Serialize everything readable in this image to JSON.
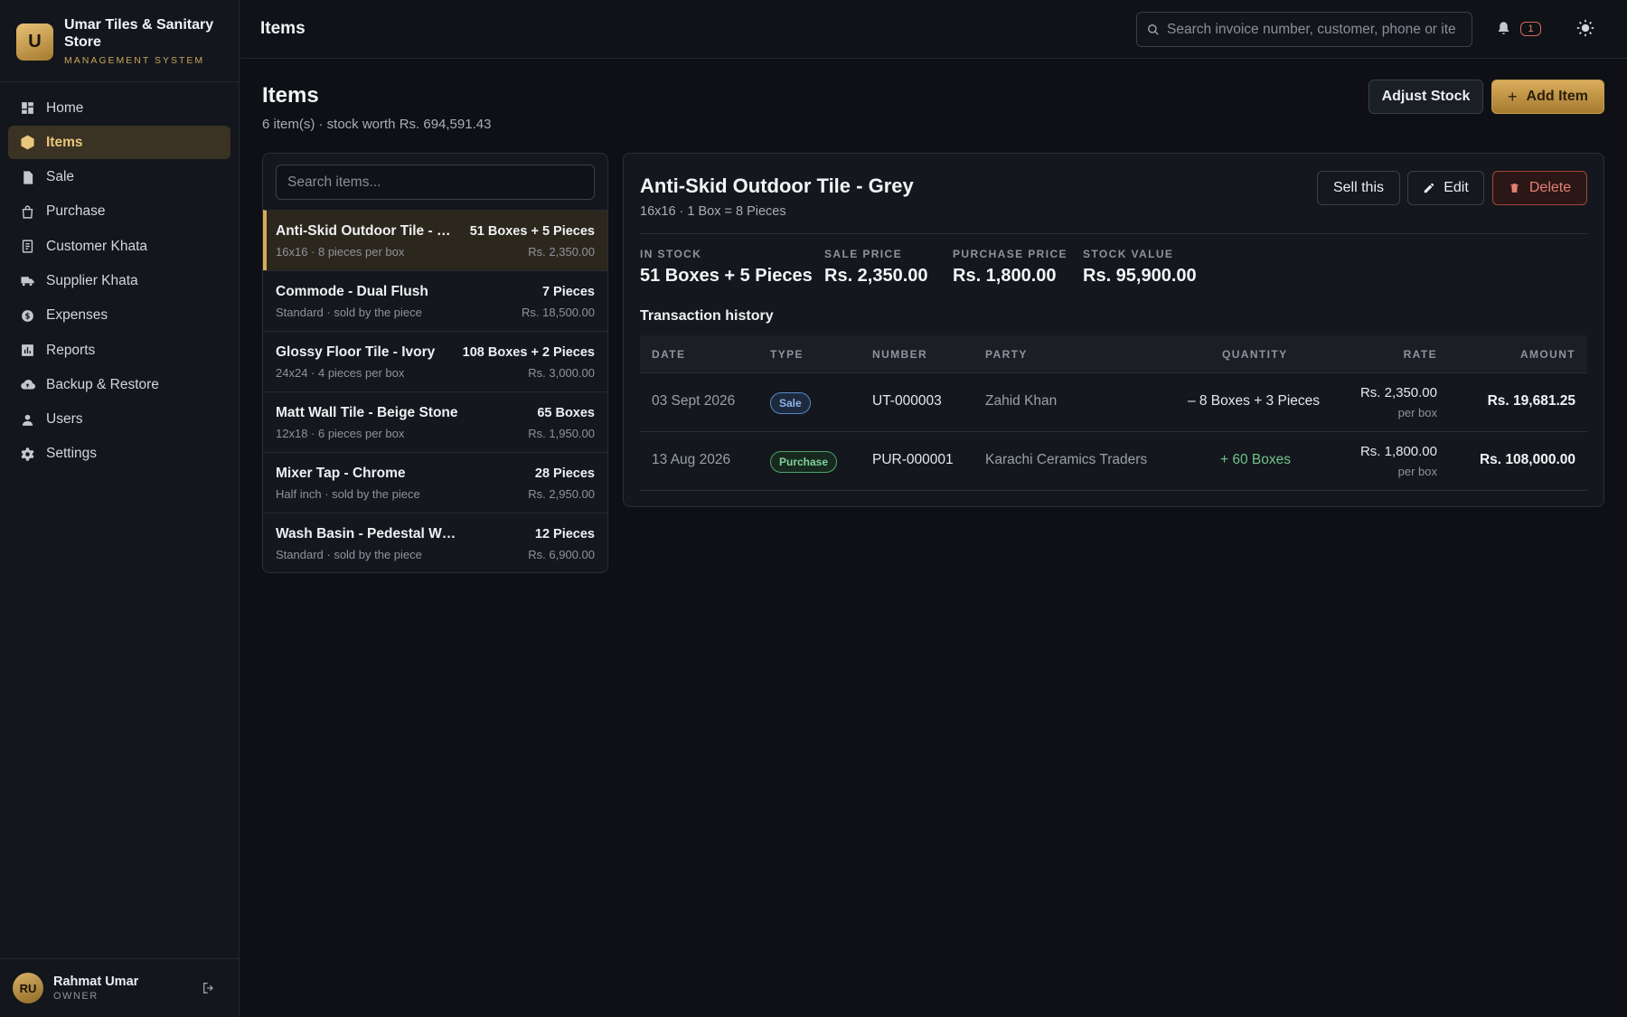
{
  "brand": {
    "logo_letter": "U",
    "name_line1": "Umar Tiles & Sanitary",
    "name_line2": "Store",
    "subtitle": "MANAGEMENT SYSTEM"
  },
  "nav": [
    {
      "label": "Home",
      "icon": "dashboard-icon"
    },
    {
      "label": "Items",
      "icon": "box-icon",
      "active": true
    },
    {
      "label": "Sale",
      "icon": "document-icon"
    },
    {
      "label": "Purchase",
      "icon": "shopping-bag-icon"
    },
    {
      "label": "Customer Khata",
      "icon": "ledger-icon"
    },
    {
      "label": "Supplier Khata",
      "icon": "truck-icon"
    },
    {
      "label": "Expenses",
      "icon": "coin-icon"
    },
    {
      "label": "Reports",
      "icon": "chart-icon"
    },
    {
      "label": "Backup & Restore",
      "icon": "cloud-upload-icon"
    },
    {
      "label": "Users",
      "icon": "user-icon"
    },
    {
      "label": "Settings",
      "icon": "gear-icon"
    }
  ],
  "user": {
    "initials": "RU",
    "name": "Rahmat Umar",
    "role": "OWNER"
  },
  "topbar": {
    "title": "Items",
    "search_placeholder": "Search invoice number, customer, phone or item",
    "notification_count": "1"
  },
  "page": {
    "title": "Items",
    "subtitle": "6 item(s) · stock worth Rs. 694,591.43",
    "adjust_label": "Adjust Stock",
    "add_label": "Add Item"
  },
  "list": {
    "search_placeholder": "Search items...",
    "items": [
      {
        "name": "Anti-Skid Outdoor Tile - Grey",
        "desc": "16x16 · 8 pieces per box",
        "qty": "51 Boxes + 5 Pieces",
        "price": "Rs. 2,350.00",
        "selected": true
      },
      {
        "name": "Commode - Dual Flush",
        "desc": "Standard · sold by the piece",
        "qty": "7 Pieces",
        "price": "Rs. 18,500.00"
      },
      {
        "name": "Glossy Floor Tile - Ivory",
        "desc": "24x24 · 4 pieces per box",
        "qty": "108 Boxes + 2 Pieces",
        "price": "Rs. 3,000.00"
      },
      {
        "name": "Matt Wall Tile - Beige Stone",
        "desc": "12x18 · 6 pieces per box",
        "qty": "65 Boxes",
        "price": "Rs. 1,950.00"
      },
      {
        "name": "Mixer Tap - Chrome",
        "desc": "Half inch · sold by the piece",
        "qty": "28 Pieces",
        "price": "Rs. 2,950.00"
      },
      {
        "name": "Wash Basin - Pedestal White",
        "desc": "Standard · sold by the piece",
        "qty": "12 Pieces",
        "price": "Rs. 6,900.00"
      }
    ]
  },
  "detail": {
    "title": "Anti-Skid Outdoor Tile - Grey",
    "subtitle": "16x16 · 1 Box = 8 Pieces",
    "sell_label": "Sell this",
    "edit_label": "Edit",
    "delete_label": "Delete",
    "stats": [
      {
        "label": "IN STOCK",
        "value": "51 Boxes + 5 Pieces"
      },
      {
        "label": "SALE PRICE",
        "value": "Rs. 2,350.00"
      },
      {
        "label": "PURCHASE PRICE",
        "value": "Rs. 1,800.00"
      },
      {
        "label": "STOCK VALUE",
        "value": "Rs. 95,900.00"
      }
    ],
    "history_title": "Transaction history",
    "columns": [
      "DATE",
      "TYPE",
      "NUMBER",
      "PARTY",
      "QUANTITY",
      "RATE",
      "AMOUNT"
    ],
    "transactions": [
      {
        "date": "03 Sept 2026",
        "type": "Sale",
        "number": "UT-000003",
        "party": "Zahid Khan",
        "quantity": "– 8 Boxes + 3 Pieces",
        "rate": "Rs. 2,350.00",
        "rate_unit": "per box",
        "amount": "Rs. 19,681.25"
      },
      {
        "date": "13 Aug 2026",
        "type": "Purchase",
        "number": "PUR-000001",
        "party": "Karachi Ceramics Traders",
        "quantity": "+ 60 Boxes",
        "rate": "Rs. 1,800.00",
        "rate_unit": "per box",
        "amount": "Rs. 108,000.00"
      }
    ]
  },
  "colors": {
    "accent": "#d7ac58",
    "sale": "#8fb4ea",
    "purchase": "#7fd39b",
    "danger": "#e68070"
  }
}
